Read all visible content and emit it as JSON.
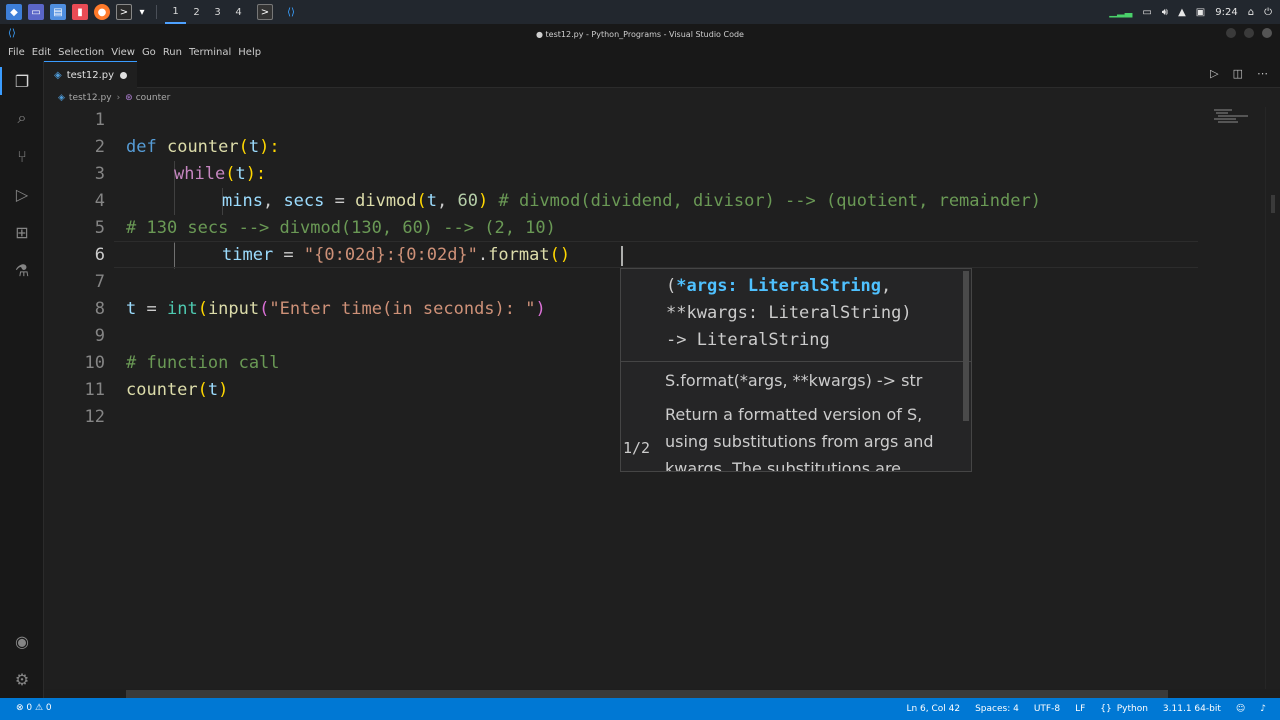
{
  "os": {
    "workspaces": [
      "1",
      "2",
      "3",
      "4"
    ],
    "time": "9:24"
  },
  "window": {
    "title": "● test12.py - Python_Programs - Visual Studio Code"
  },
  "menu": [
    "File",
    "Edit",
    "Selection",
    "View",
    "Go",
    "Run",
    "Terminal",
    "Help"
  ],
  "tab": {
    "filename": "test12.py"
  },
  "breadcrumb": {
    "file": "test12.py",
    "symbol": "counter"
  },
  "editor": {
    "line_numbers": [
      "1",
      "2",
      "3",
      "4",
      "5",
      "6",
      "7",
      "8",
      "9",
      "10",
      "11",
      "12"
    ],
    "current_line": "6",
    "code": {
      "l2": {
        "kw": "def",
        "name": "counter",
        "open": "(",
        "param": "t",
        "close": "):"
      },
      "l3": {
        "kw": "while",
        "open": "(",
        "param": "t",
        "close": "):"
      },
      "l4": {
        "a": "mins",
        "comma": ", ",
        "b": "secs",
        "eq": " = ",
        "fn": "divmod",
        "open": "(",
        "arg1": "t",
        "comma2": ", ",
        "num": "60",
        "close": ")",
        "comment": " # divmod(dividend, divisor) --> (quotient, remainder)"
      },
      "l5": {
        "comment": "# 130 secs --> divmod(130, 60) --> (2, 10)"
      },
      "l6": {
        "var": "timer",
        "eq": " = ",
        "str": "\"{0:02d}:{0:02d}\"",
        "dot": ".",
        "fn": "format",
        "parens": "()"
      },
      "l8": {
        "var": "t",
        "eq": " = ",
        "fn1": "int",
        "open1": "(",
        "fn2": "input",
        "open2": "(",
        "str": "\"Enter time(in seconds): \"",
        "close": ")"
      },
      "l10": {
        "comment": "# function call"
      },
      "l11": {
        "fn": "counter",
        "open": "(",
        "arg": "t",
        "close": ")"
      }
    }
  },
  "hint": {
    "sig_open": "(",
    "sig_active": "*args: LiteralString",
    "sig_rest1": ",",
    "sig_line2": "**kwargs: LiteralString)",
    "sig_line3": "-> LiteralString",
    "doc_sig": "S.format(*args, **kwargs) -> str",
    "doc_text": "Return a formatted version of S, using substitutions from args and kwargs. The substitutions are",
    "nav": "1/2"
  },
  "status": {
    "problems": "⊗ 0 ⚠ 0",
    "position": "Ln 6, Col 42",
    "spaces": "Spaces: 4",
    "encoding": "UTF-8",
    "eol": "LF",
    "language": "Python",
    "interpreter": "3.11.1 64-bit"
  }
}
